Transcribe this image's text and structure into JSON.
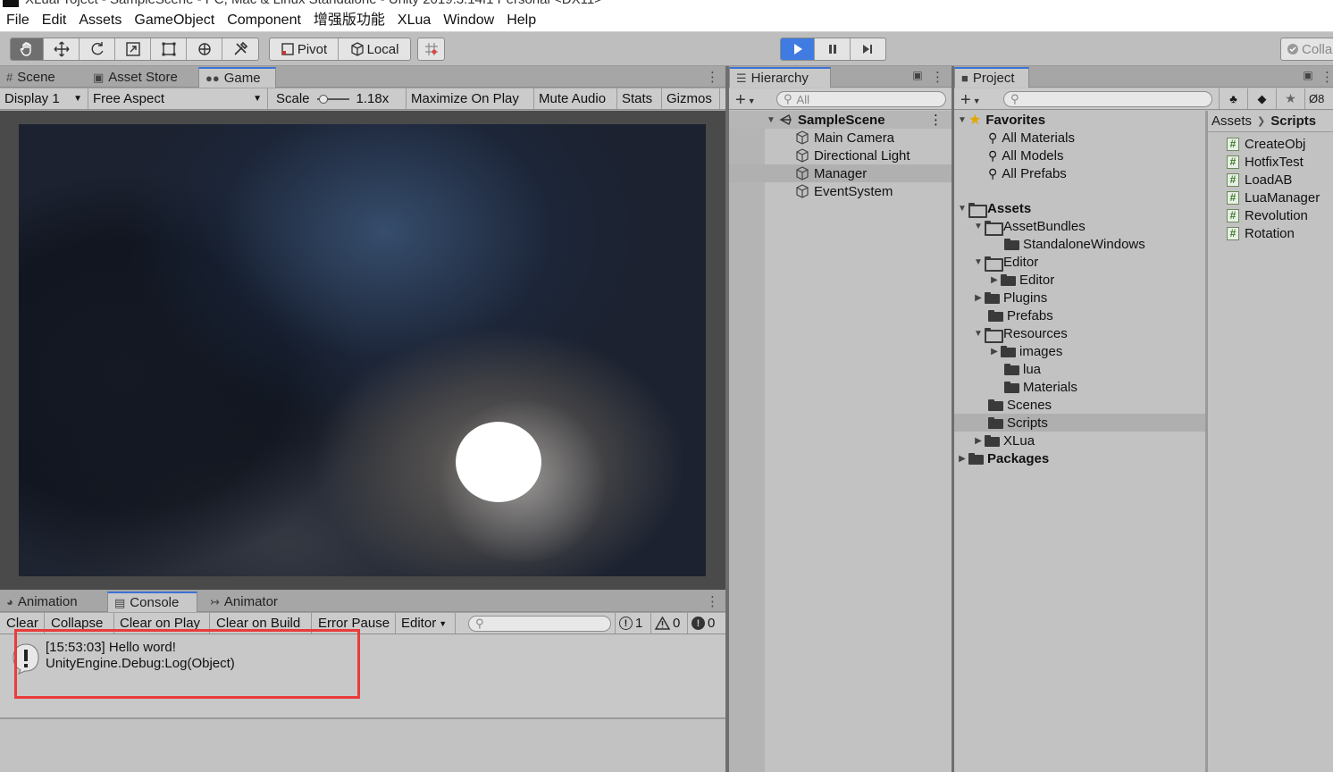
{
  "window": {
    "title": "XLuaProject - SampleScene - PC, Mac & Linux Standalone - Unity 2019.3.14f1 Personal <DX11>"
  },
  "menu": [
    "File",
    "Edit",
    "Assets",
    "GameObject",
    "Component",
    "增强版功能",
    "XLua",
    "Window",
    "Help"
  ],
  "toolbar": {
    "tools": [
      "hand-tool",
      "move-tool",
      "rotate-tool",
      "scale-tool",
      "rect-tool",
      "transform-tool",
      "custom-tool"
    ],
    "pivot_label": "Pivot",
    "local_label": "Local",
    "collab_label": "Colla"
  },
  "scene_panel": {
    "tabs": [
      "Scene",
      "Asset Store",
      "Game"
    ],
    "active_tab": "Game",
    "display": "Display 1",
    "aspect": "Free Aspect",
    "scale_label": "Scale",
    "scale_value": "1.18x",
    "toggles": [
      "Maximize On Play",
      "Mute Audio",
      "Stats",
      "Gizmos"
    ]
  },
  "console_panel": {
    "tabs": [
      "Animation",
      "Console",
      "Animator"
    ],
    "active_tab": "Console",
    "buttons": [
      "Clear",
      "Collapse",
      "Clear on Play",
      "Clear on Build",
      "Error Pause",
      "Editor"
    ],
    "log_count": "1",
    "warning_count": "0",
    "error_count": "0",
    "entries": [
      {
        "line1": "[15:53:03] Hello word!",
        "line2": "UnityEngine.Debug:Log(Object)"
      }
    ]
  },
  "hierarchy": {
    "tab": "Hierarchy",
    "search_placeholder": "All",
    "scene": "SampleScene",
    "objects": [
      "Main Camera",
      "Directional Light",
      "Manager",
      "EventSystem"
    ],
    "selected": "Manager"
  },
  "project": {
    "tab": "Project",
    "hidden_count": "8",
    "favorites_label": "Favorites",
    "favorites": [
      "All Materials",
      "All Models",
      "All Prefabs"
    ],
    "assets_label": "Assets",
    "folders": {
      "assetbundles": "AssetBundles",
      "standalonewindows": "StandaloneWindows",
      "editor": "Editor",
      "editor_child": "Editor",
      "plugins": "Plugins",
      "prefabs": "Prefabs",
      "resources": "Resources",
      "images": "images",
      "lua": "lua",
      "materials": "Materials",
      "scenes": "Scenes",
      "scripts": "Scripts",
      "xlua": "XLua"
    },
    "packages_label": "Packages",
    "breadcrumb": [
      "Assets",
      "Scripts"
    ],
    "scripts": [
      "CreateObj",
      "HotfixTest",
      "LoadAB",
      "LuaManager",
      "Revolution",
      "Rotation"
    ]
  }
}
